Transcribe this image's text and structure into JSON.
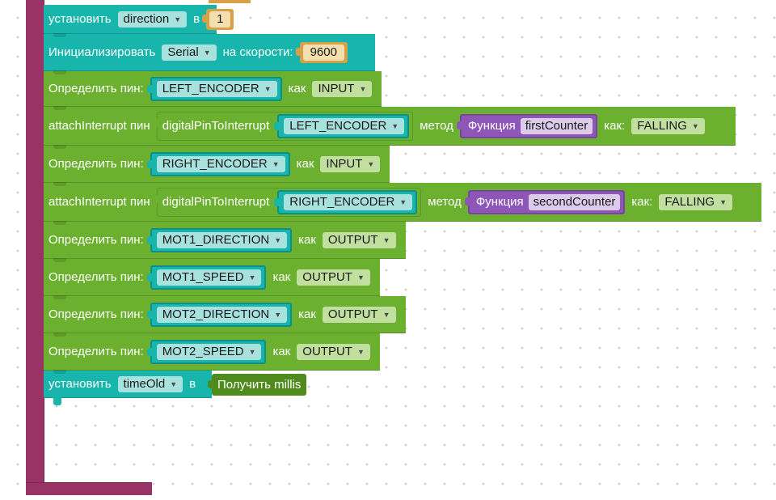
{
  "blocks": {
    "set_direction": {
      "label": "установить",
      "var": "direction",
      "to": "в",
      "value": "1"
    },
    "serial_init": {
      "label": "Инициализировать",
      "port": "Serial",
      "speed_label": "на скорости:",
      "speed": "9600"
    },
    "pin1": {
      "label": "Определить пин:",
      "pin": "LEFT_ENCODER",
      "as": "как",
      "mode": "INPUT"
    },
    "attach1": {
      "label": "attachInterrupt пин",
      "func": "digitalPinToInterrupt",
      "pin": "LEFT_ENCODER",
      "method": "метод",
      "fn_label": "Функция",
      "fn_name": "firstCounter",
      "as": "как:",
      "edge": "FALLING"
    },
    "pin2": {
      "label": "Определить пин:",
      "pin": "RIGHT_ENCODER",
      "as": "как",
      "mode": "INPUT"
    },
    "attach2": {
      "label": "attachInterrupt пин",
      "func": "digitalPinToInterrupt",
      "pin": "RIGHT_ENCODER",
      "method": "метод",
      "fn_label": "Функция",
      "fn_name": "secondCounter",
      "as": "как:",
      "edge": "FALLING"
    },
    "pin3": {
      "label": "Определить пин:",
      "pin": "MOT1_DIRECTION",
      "as": "как",
      "mode": "OUTPUT"
    },
    "pin4": {
      "label": "Определить пин:",
      "pin": "MOT1_SPEED",
      "as": "как",
      "mode": "OUTPUT"
    },
    "pin5": {
      "label": "Определить пин:",
      "pin": "MOT2_DIRECTION",
      "as": "как",
      "mode": "OUTPUT"
    },
    "pin6": {
      "label": "Определить пин:",
      "pin": "MOT2_SPEED",
      "as": "как",
      "mode": "OUTPUT"
    },
    "set_time": {
      "label": "установить",
      "var": "timeOld",
      "to": "в",
      "value_block": "Получить millis"
    }
  },
  "dropdown_arrow": "▼",
  "colors": {
    "teal": "#18b5ad",
    "green": "#6bb02e",
    "purple_container": "#993366",
    "orange_number": "#d8a148",
    "function_purple": "#8e56b6",
    "millis_green": "#4f8a1c"
  }
}
